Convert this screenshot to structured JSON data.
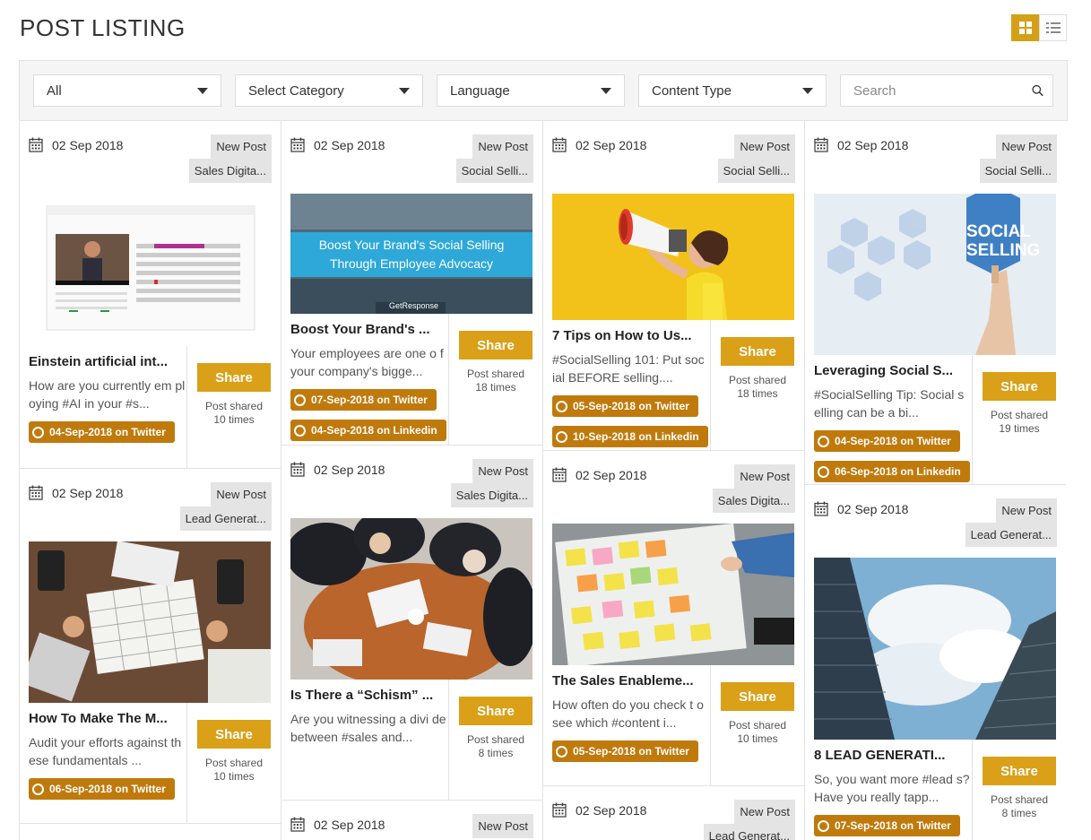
{
  "page_title": "POST LISTING",
  "filters": {
    "status": "All",
    "category": "Select Category",
    "language": "Language",
    "content_type": "Content Type",
    "search_placeholder": "Search"
  },
  "share_label": "Share",
  "posts": [
    {
      "date": "02 Sep 2018",
      "tag1": "New Post",
      "tag2": "Sales Digita...",
      "title": "Einstein artificial int...",
      "desc": "How are you currently em ploying #AI in your #s...",
      "shared_line1": "Post shared",
      "shared_line2": "10 times",
      "schedules": [
        "04-Sep-2018 on Twitter"
      ],
      "image_icon": "dashboard-screenshot"
    },
    {
      "date": "02 Sep 2018",
      "tag1": "New Post",
      "tag2": "Lead Generat...",
      "title": "How To Make The M...",
      "desc": "Audit your efforts against these fundamentals ...",
      "shared_line1": "Post shared",
      "shared_line2": "10 times",
      "schedules": [
        "06-Sep-2018 on Twitter"
      ],
      "image_icon": "desk-calendar-photo"
    },
    {
      "date": "02 Sep 2018",
      "tag1": "New Post",
      "tag2": "Social Selli...",
      "title": "Boost Your Brand's ...",
      "desc": "Your employees are one o f your company's bigge...",
      "shared_line1": "Post shared",
      "shared_line2": "18 times",
      "schedules": [
        "07-Sep-2018 on Twitter",
        "04-Sep-2018 on Linkedin"
      ],
      "image_icon": "banner-image",
      "banner_line1": "Boost Your Brand's Social Selling",
      "banner_line2": "Through Employee Advocacy",
      "banner_logo": "GetResponse"
    },
    {
      "date": "02 Sep 2018",
      "tag1": "New Post",
      "tag2": "Sales Digita...",
      "title": "Is There a “Schism” ...",
      "desc": "Are you witnessing a divi de between #sales and...",
      "shared_line1": "Post shared",
      "shared_line2": "8 times",
      "schedules": [],
      "image_icon": "meeting-photo"
    },
    {
      "date": "02 Sep 2018",
      "tag1": "New Post",
      "tag2": "",
      "title": "",
      "desc": "",
      "shared_line1": "",
      "shared_line2": "",
      "schedules": [],
      "image_icon": ""
    },
    {
      "date": "02 Sep 2018",
      "tag1": "New Post",
      "tag2": "Social Selli...",
      "title": "7 Tips on How to Us...",
      "desc": "#SocialSelling 101: Put soc ial BEFORE selling....",
      "shared_line1": "Post shared",
      "shared_line2": "18 times",
      "schedules": [
        "05-Sep-2018 on Twitter",
        "10-Sep-2018 on Linkedin"
      ],
      "image_icon": "megaphone-photo"
    },
    {
      "date": "02 Sep 2018",
      "tag1": "New Post",
      "tag2": "Sales Digita...",
      "title": "The Sales Enableme...",
      "desc": "How often do you check t o see which #content i...",
      "shared_line1": "Post shared",
      "shared_line2": "10 times",
      "schedules": [
        "05-Sep-2018 on Twitter"
      ],
      "image_icon": "sticky-notes-photo"
    },
    {
      "date": "02 Sep 2018",
      "tag1": "New Post",
      "tag2": "Lead Generat...",
      "title": "",
      "desc": "",
      "shared_line1": "",
      "shared_line2": "",
      "schedules": [],
      "image_icon": ""
    },
    {
      "date": "02 Sep 2018",
      "tag1": "New Post",
      "tag2": "Social Selli...",
      "title": "Leveraging Social S...",
      "desc": "#SocialSelling Tip: Social selling can be a bi...",
      "shared_line1": "Post shared",
      "shared_line2": "19 times",
      "schedules": [
        "04-Sep-2018 on Twitter",
        "06-Sep-2018 on Linkedin"
      ],
      "image_icon": "social-selling-image",
      "image_text1": "SOCIAL",
      "image_text2": "SELLING"
    },
    {
      "date": "02 Sep 2018",
      "tag1": "New Post",
      "tag2": "Lead Generat...",
      "title": "8 LEAD GENERATI...",
      "desc": "So, you want more #lead s? Have you really tapp...",
      "shared_line1": "Post shared",
      "shared_line2": "8 times",
      "schedules": [
        "07-Sep-2018 on Twitter"
      ],
      "image_icon": "skyscraper-photo"
    }
  ],
  "colors": {
    "accent": "#d9a018",
    "schedule_pill": "#c07a0c",
    "tag_bg": "#e4e4e4"
  }
}
